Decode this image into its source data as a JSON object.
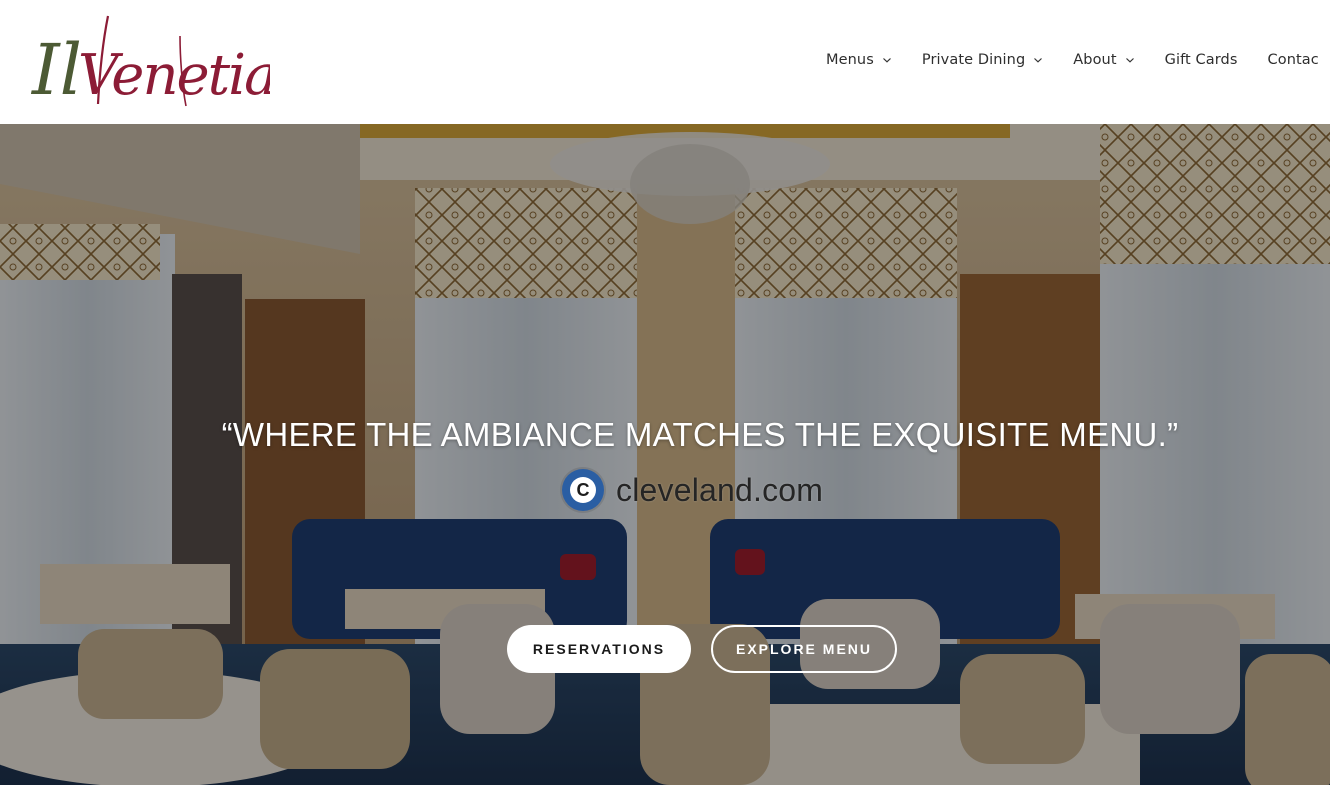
{
  "brand": {
    "logo_text_part1": "Il",
    "logo_text_part2": "Venetian",
    "colors": {
      "logo_green": "#4c5a34",
      "logo_wine": "#8c1c36"
    }
  },
  "nav": {
    "items": [
      {
        "label": "Menus",
        "has_dropdown": true
      },
      {
        "label": "Private Dining",
        "has_dropdown": true
      },
      {
        "label": "About",
        "has_dropdown": true
      },
      {
        "label": "Gift Cards",
        "has_dropdown": false
      },
      {
        "label": "Contac",
        "has_dropdown": false
      }
    ],
    "chevron_icon": "chevron-down-icon"
  },
  "hero": {
    "quote": "“WHERE THE AMBIANCE MATCHES THE EXQUISITE MENU.”",
    "source": {
      "badge_letter": "C",
      "name": "cleveland.com",
      "badge_color": "#2a5ea3"
    },
    "buttons": {
      "reservations": "RESERVATIONS",
      "explore_menu": "EXPLORE MENU"
    }
  }
}
